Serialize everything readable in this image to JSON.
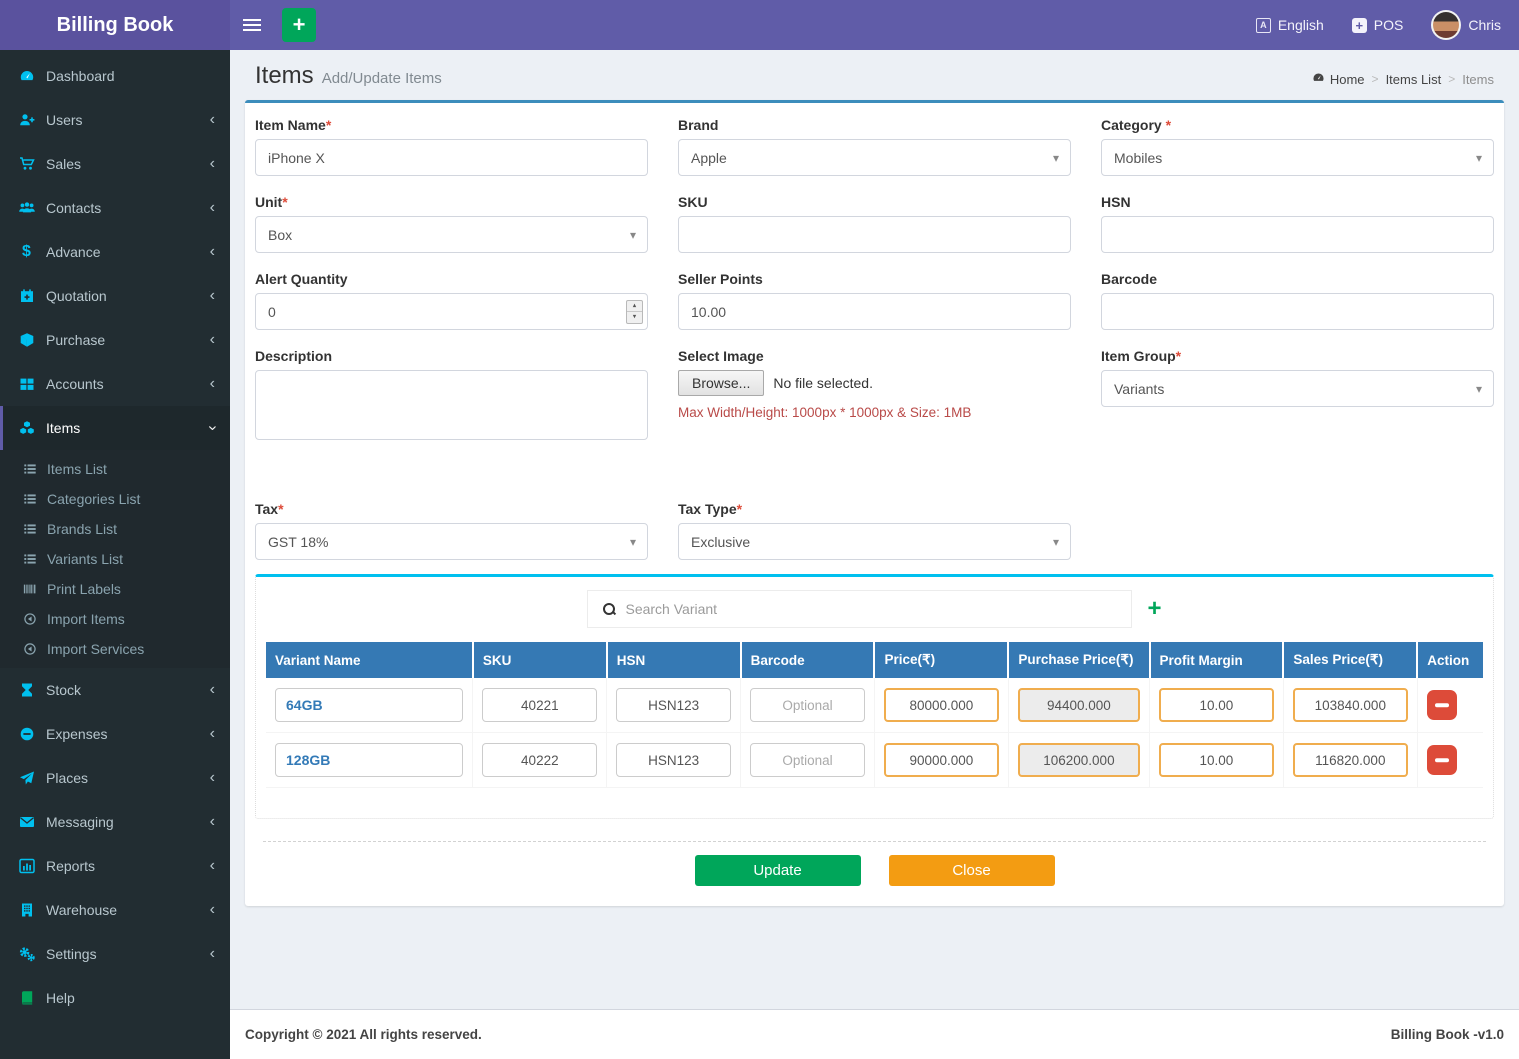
{
  "topbar": {
    "brand": "Billing Book",
    "language": "English",
    "pos": "POS",
    "username": "Chris"
  },
  "page": {
    "title": "Items",
    "subtitle": "Add/Update Items",
    "breadcrumb": [
      {
        "label": "Home",
        "icon": "gauge"
      },
      {
        "label": "Items List"
      },
      {
        "label": "Items",
        "current": true
      }
    ]
  },
  "sidebar": {
    "items": [
      {
        "label": "Dashboard",
        "icon": "gauge"
      },
      {
        "label": "Users",
        "icon": "user-plus",
        "chevron": true
      },
      {
        "label": "Sales",
        "icon": "cart",
        "chevron": true
      },
      {
        "label": "Contacts",
        "icon": "users",
        "chevron": true
      },
      {
        "label": "Advance",
        "icon": "dollar",
        "chevron": true
      },
      {
        "label": "Quotation",
        "icon": "calendar-plus",
        "chevron": true
      },
      {
        "label": "Purchase",
        "icon": "cube",
        "chevron": true
      },
      {
        "label": "Accounts",
        "icon": "grid",
        "chevron": true
      },
      {
        "label": "Items",
        "icon": "cubes",
        "active": true,
        "children": [
          {
            "label": "Items List",
            "icon": "list"
          },
          {
            "label": "Categories List",
            "icon": "list"
          },
          {
            "label": "Brands List",
            "icon": "list"
          },
          {
            "label": "Variants List",
            "icon": "list"
          },
          {
            "label": "Print Labels",
            "icon": "barcode"
          },
          {
            "label": "Import Items",
            "icon": "import"
          },
          {
            "label": "Import Services",
            "icon": "import"
          }
        ]
      },
      {
        "label": "Stock",
        "icon": "hourglass",
        "chevron": true
      },
      {
        "label": "Expenses",
        "icon": "minus-circle",
        "chevron": true
      },
      {
        "label": "Places",
        "icon": "plane",
        "chevron": true
      },
      {
        "label": "Messaging",
        "icon": "envelope",
        "chevron": true
      },
      {
        "label": "Reports",
        "icon": "chart",
        "chevron": true
      },
      {
        "label": "Warehouse",
        "icon": "building",
        "chevron": true
      },
      {
        "label": "Settings",
        "icon": "gears",
        "chevron": true
      },
      {
        "label": "Help",
        "icon": "book",
        "green": true
      }
    ]
  },
  "form": {
    "fields": [
      {
        "name": "item-name",
        "label": "Item Name",
        "mark": "*",
        "type": "text",
        "value": "iPhone X"
      },
      {
        "name": "brand",
        "label": "Brand",
        "mark": "",
        "type": "select",
        "value": "Apple"
      },
      {
        "name": "category",
        "label": "Category",
        "mark": " *",
        "type": "select",
        "value": "Mobiles"
      },
      {
        "name": "unit",
        "label": "Unit",
        "mark": "*",
        "type": "select",
        "value": "Box"
      },
      {
        "name": "sku",
        "label": "SKU",
        "mark": "",
        "type": "text",
        "value": ""
      },
      {
        "name": "hsn",
        "label": "HSN",
        "mark": "",
        "type": "text",
        "value": ""
      },
      {
        "name": "alert-quantity",
        "label": "Alert Quantity",
        "mark": "",
        "type": "number",
        "value": "0"
      },
      {
        "name": "seller-points",
        "label": "Seller Points",
        "mark": "",
        "type": "text",
        "value": "10.00"
      },
      {
        "name": "barcode",
        "label": "Barcode",
        "mark": "",
        "type": "text",
        "value": ""
      },
      {
        "name": "description",
        "label": "Description",
        "mark": "",
        "type": "textarea",
        "value": ""
      },
      {
        "name": "select-image",
        "label": "Select Image",
        "mark": "",
        "type": "file",
        "browse_label": "Browse...",
        "file_status": "No file selected.",
        "note": "Max Width/Height: 1000px * 1000px & Size: 1MB"
      },
      {
        "name": "item-group",
        "label": "Item Group",
        "mark": "*",
        "type": "select",
        "value": "Variants"
      },
      {
        "name": "tax",
        "label": "Tax",
        "mark": "*",
        "type": "select",
        "value": "GST 18%"
      },
      {
        "name": "tax-type",
        "label": "Tax Type",
        "mark": "*",
        "type": "select",
        "value": "Exclusive"
      }
    ]
  },
  "variants": {
    "search_placeholder": "Search Variant",
    "add_label": "+",
    "columns": [
      "Variant Name",
      "SKU",
      "HSN",
      "Barcode",
      "Price(₹)",
      "Purchase Price(₹)",
      "Profit Margin",
      "Sales Price(₹)",
      "Action"
    ],
    "rows": [
      {
        "variant": "64GB",
        "sku": "40221",
        "hsn": "HSN123",
        "barcode_placeholder": "Optional",
        "price": "80000.000",
        "purchase_price": "94400.000",
        "profit_margin": "10.00",
        "sales_price": "103840.000"
      },
      {
        "variant": "128GB",
        "sku": "40222",
        "hsn": "HSN123",
        "barcode_placeholder": "Optional",
        "price": "90000.000",
        "purchase_price": "106200.000",
        "profit_margin": "10.00",
        "sales_price": "116820.000"
      }
    ]
  },
  "actions": {
    "update": "Update",
    "close": "Close"
  },
  "footer": {
    "left": "Copyright © 2021 All rights reserved.",
    "right": "Billing Book -v1.0"
  },
  "colors": {
    "navbar_purple": "#605ca8",
    "logo_purple": "#5a529e",
    "sidebar_dark": "#222d32",
    "icon_cyan": "#00c0ef",
    "card_border_blue": "#3c8dbc",
    "table_header_blue": "#3579b4",
    "green": "#00a65a",
    "orange": "#f39c12",
    "red": "#dd4b39",
    "warning_border": "#f0ad4e",
    "content_bg": "#ecf0f5"
  }
}
